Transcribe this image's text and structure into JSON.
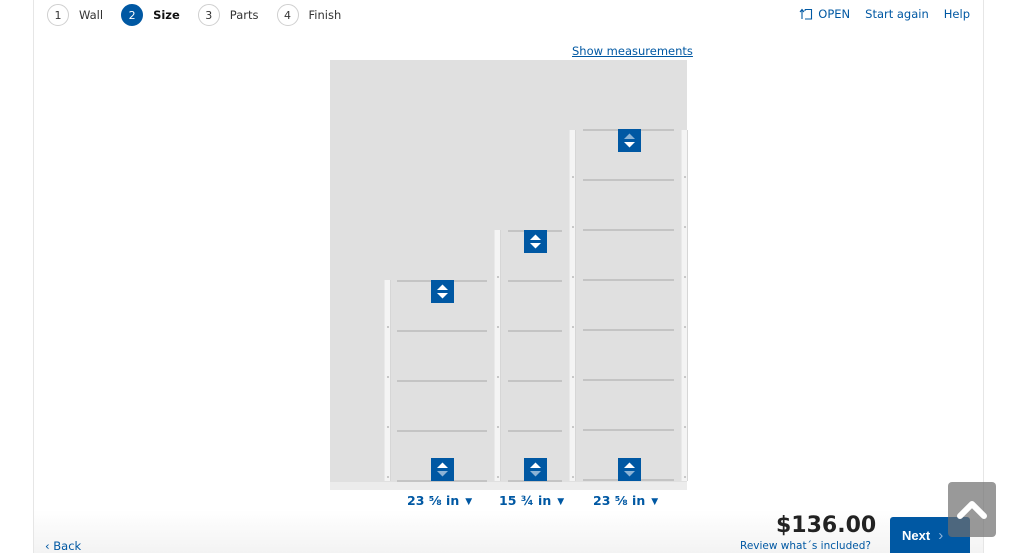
{
  "steps": [
    {
      "num": "1",
      "label": "Wall",
      "active": false
    },
    {
      "num": "2",
      "label": "Size",
      "active": true
    },
    {
      "num": "3",
      "label": "Parts",
      "active": false
    },
    {
      "num": "4",
      "label": "Finish",
      "active": false
    }
  ],
  "toplinks": {
    "open": "OPEN",
    "open_icon": "open-file-icon",
    "start_again": "Start again",
    "help": "Help"
  },
  "show_measurements": "Show measurements",
  "sections": [
    {
      "width_label": "23 ⅝ in",
      "caret": "▼"
    },
    {
      "width_label": "15 ¾ in",
      "caret": "▼"
    },
    {
      "width_label": "23 ⅝ in",
      "caret": "▼"
    }
  ],
  "footer": {
    "back": "Back",
    "price": "$136.00",
    "review": "Review what´s included?",
    "next": "Next",
    "next_chevron": "›",
    "scroll_top_icon": "chevron-up-icon"
  },
  "colors": {
    "accent": "#0058a3",
    "canvas": "#e0e0e0"
  }
}
